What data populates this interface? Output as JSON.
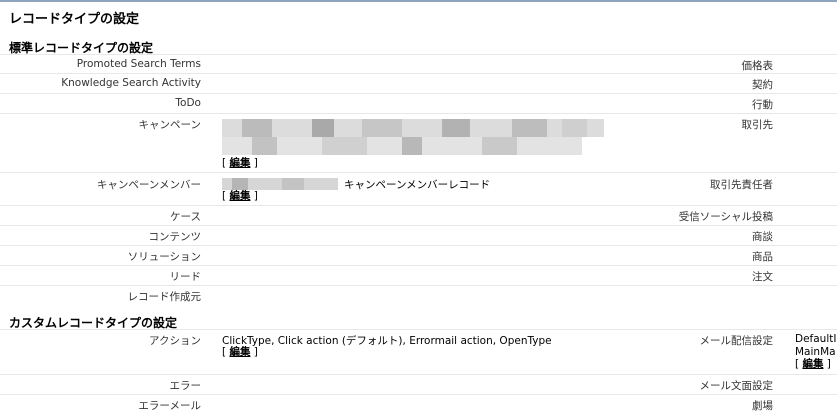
{
  "page": {
    "title": "レコードタイプの設定"
  },
  "standard": {
    "heading": "標準レコードタイプの設定",
    "rows": [
      {
        "left": "Promoted Search Terms",
        "right": "価格表"
      },
      {
        "left": "Knowledge Search Activity",
        "right": "契約"
      },
      {
        "left": "ToDo",
        "right": "行動"
      },
      {
        "left": "キャンペーン",
        "right": "取引先",
        "edit": "編集"
      },
      {
        "left": "キャンペーンメンバー",
        "right": "取引先責任者",
        "value": "キャンペーンメンバーレコード",
        "edit": "編集"
      },
      {
        "left": "ケース",
        "right": "受信ソーシャル投稿"
      },
      {
        "left": "コンテンツ",
        "right": "商談"
      },
      {
        "left": "ソリューション",
        "right": "商品"
      },
      {
        "left": "リード",
        "right": "注文"
      },
      {
        "left": "レコード作成元",
        "right": ""
      }
    ]
  },
  "custom": {
    "heading": "カスタムレコードタイプの設定",
    "rows": [
      {
        "left": "アクション",
        "right": "メール配信設定",
        "value": "ClickType, Click action (デフォルト), Errormail action, OpenType",
        "edit": "編集",
        "right_value_1": "DefaultI",
        "right_value_2": "MainMa",
        "right_edit": "編集"
      },
      {
        "left": "エラー",
        "right": "メール文面設定"
      },
      {
        "left": "エラーメール",
        "right": "劇場"
      }
    ]
  },
  "edit_bracket_open": "[",
  "edit_bracket_close": "]"
}
